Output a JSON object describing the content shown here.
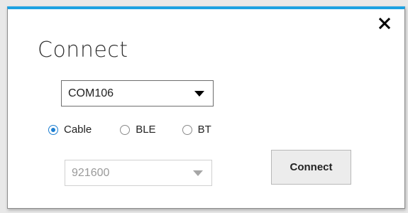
{
  "dialog": {
    "title": "Connect",
    "close_icon": "close-icon",
    "accent_color": "#1ba1e2"
  },
  "port_select": {
    "value": "COM106",
    "icon": "dropdown-arrow-icon"
  },
  "connection_type": {
    "options": [
      {
        "label": "Cable",
        "checked": true
      },
      {
        "label": "BLE",
        "checked": false
      },
      {
        "label": "BT",
        "checked": false
      }
    ]
  },
  "baud_select": {
    "value": "921600",
    "disabled": true,
    "icon": "dropdown-arrow-icon"
  },
  "connect_button": {
    "label": "Connect"
  }
}
